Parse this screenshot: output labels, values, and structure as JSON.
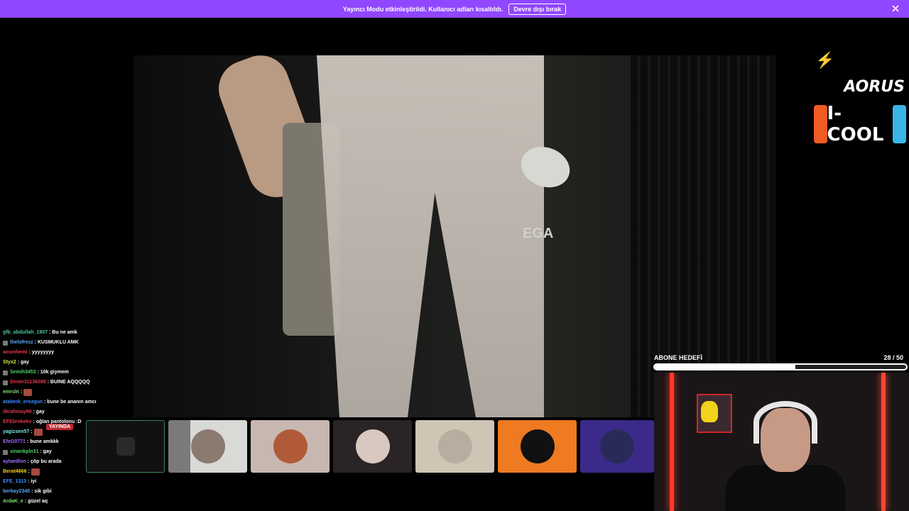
{
  "banner": {
    "text": "Yayıncı Modu etkinleştirildi. Kullanıcı adları kısaltıldı.",
    "button_label": "Devre dışı bırak",
    "close_icon": "close-icon"
  },
  "stream": {
    "scene_logo_text": "EGA"
  },
  "sponsors": {
    "aorus": "AORUS",
    "icool": "I-COOL"
  },
  "chat": {
    "messages": [
      {
        "user": "gfb_abdullah_1907",
        "text": ": Bu ne amk",
        "color": "#4fc3a1",
        "badge": false
      },
      {
        "user": "thelofrezz",
        "text": ": KUSMUKLU AMK",
        "color": "#5aa8ff",
        "badge": true
      },
      {
        "user": "aosinhemi",
        "text": ": yyyyyyyy",
        "color": "#e0394a",
        "badge": false
      },
      {
        "user": "Styx2",
        "text": ": gay",
        "color": "#d8e84a",
        "badge": false
      },
      {
        "user": "Semih3453",
        "text": ": 10k giymem",
        "color": "#4fd26a",
        "badge": true
      },
      {
        "user": "Demir31136098",
        "text": ": BUINE AQQQQQ",
        "color": "#e0394a",
        "badge": true
      },
      {
        "user": "emrsln",
        "text": ":",
        "color": "#7be36a",
        "badge": false,
        "emote": true
      },
      {
        "user": "ataberk_erozgun",
        "text": ": bune be ananın amcı",
        "color": "#3a8cff",
        "badge": false
      },
      {
        "user": "ilkrahmay90",
        "text": ": gay",
        "color": "#e0394a",
        "badge": false
      },
      {
        "user": "EFEbrokeke",
        "text": ": oğlan pantolonu :D",
        "color": "#e0394a",
        "badge": false
      },
      {
        "user": "yagizsen57",
        "text": ":",
        "color": "#7be3e3",
        "badge": false,
        "emote": true
      },
      {
        "user": "EfeG0771",
        "text": ": bune amkkk",
        "color": "#a06aff",
        "badge": false
      },
      {
        "user": "sinankpln31",
        "text": ": gay",
        "color": "#4fd26a",
        "badge": true
      },
      {
        "user": "aytaedlon",
        "text": ": çöp bu arada",
        "color": "#a06aff",
        "badge": false
      },
      {
        "user": "Berat4666",
        "text": ":",
        "color": "#f2d21a",
        "badge": false,
        "emote": true
      },
      {
        "user": "EFE_1313",
        "text": ": iyi",
        "color": "#3a8cff",
        "badge": false
      },
      {
        "user": "berkay2345",
        "text": ": sik gibi",
        "color": "#5aa8ff",
        "badge": false
      },
      {
        "user": "ArdaK_e",
        "text": ": güzel aq",
        "color": "#7be36a",
        "badge": false
      }
    ]
  },
  "live_badge": "YAYINDA",
  "friends": {
    "tiles": [
      {
        "name": "tile-0"
      },
      {
        "name": "tile-1"
      },
      {
        "name": "tile-2"
      },
      {
        "name": "tile-3"
      },
      {
        "name": "tile-4"
      },
      {
        "name": "tile-5"
      },
      {
        "name": "tile-6"
      }
    ]
  },
  "goal": {
    "title": "ABONE HEDEFİ",
    "count": "28  /  50",
    "current": 28,
    "target": 50
  }
}
